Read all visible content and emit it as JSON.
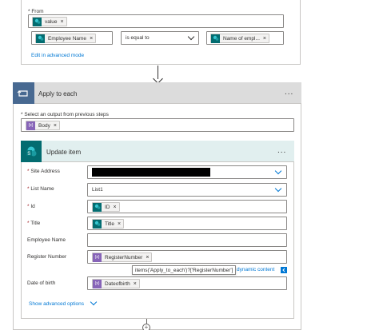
{
  "filter": {
    "from_label": "* From",
    "from_token": "value",
    "cond_left_token": "Employee Name",
    "operator": "is equal to",
    "cond_right_token": "Name of empl...",
    "advanced_link": "Edit in advanced mode"
  },
  "loop": {
    "title": "Apply to each",
    "select_label": "* Select an output from previous steps",
    "select_token": "Body",
    "more": "..."
  },
  "update_item": {
    "title": "Update item",
    "more": "...",
    "fields": {
      "site_address": {
        "label": "Site Address",
        "required": true,
        "value": ""
      },
      "list_name": {
        "label": "List Name",
        "required": true,
        "value": "List1"
      },
      "id": {
        "label": "Id",
        "required": true,
        "token": "ID"
      },
      "title": {
        "label": "Title",
        "required": true,
        "token": "Title"
      },
      "employee_name": {
        "label": "Employee Name",
        "required": false
      },
      "register_number": {
        "label": "Register Number",
        "required": false,
        "token": "RegisterNumber"
      },
      "date_of_birth": {
        "label": "Date of birth",
        "required": false,
        "token": "Dateofbirth"
      }
    },
    "tooltip": "items('Apply_to_each')?['RegisterNumber']",
    "dynamic_link": "dynamic content",
    "show_advanced": "Show advanced options"
  },
  "colors": {
    "sharepoint": "#036c70",
    "variable": "#8764b8",
    "loop_icon": "#486991",
    "link": "#0078d4"
  }
}
